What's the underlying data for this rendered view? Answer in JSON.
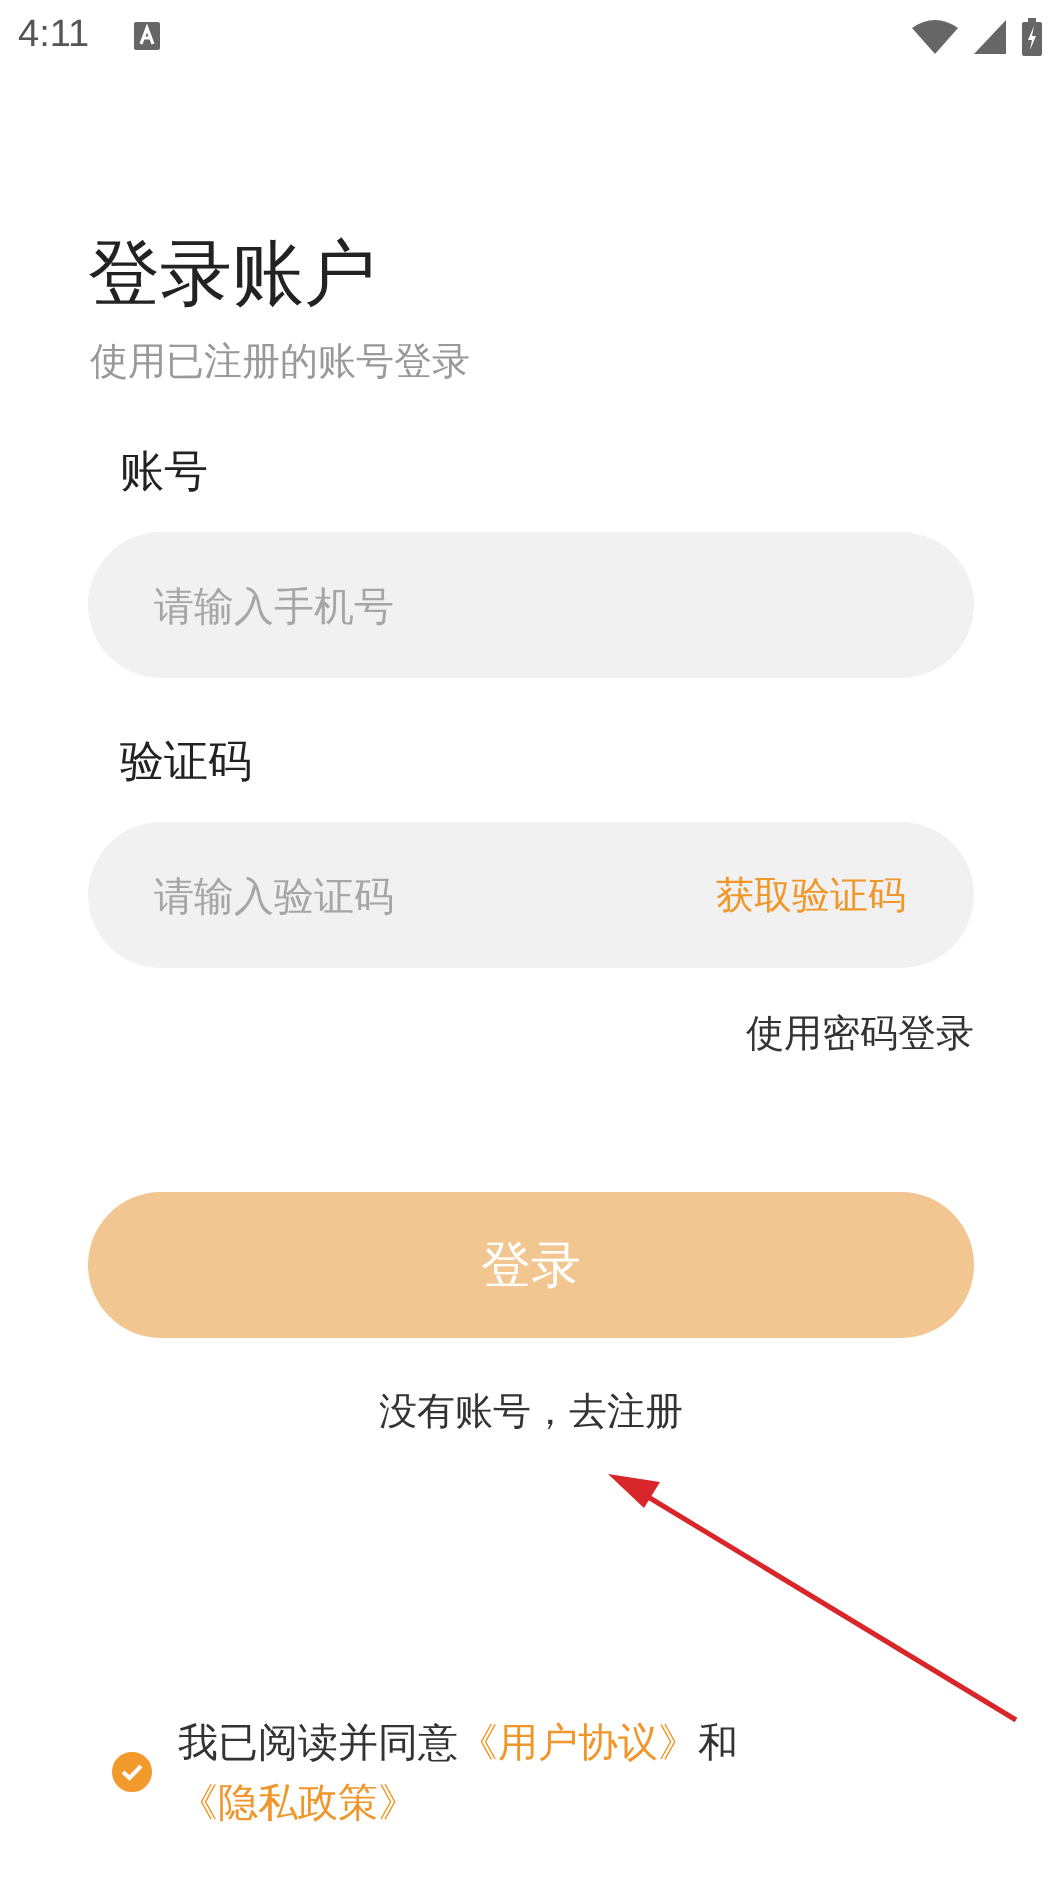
{
  "status_bar": {
    "time": "4:11"
  },
  "title": "登录账户",
  "subtitle": "使用已注册的账号登录",
  "fields": [
    {
      "label": "账号",
      "placeholder": "请输入手机号"
    },
    {
      "label": "验证码",
      "placeholder": "请输入验证码",
      "action": "获取验证码"
    }
  ],
  "password_login_link": "使用密码登录",
  "login_button": {
    "label": "登录",
    "disabled": true
  },
  "register_link": "没有账号，去注册",
  "agreement": {
    "checked": true,
    "parts": [
      {
        "kind": "text",
        "text": "我已阅读并同意"
      },
      {
        "kind": "link",
        "text": "《用户协议》"
      },
      {
        "kind": "text",
        "text": "和"
      },
      {
        "kind": "link",
        "text": "《隐私政策》"
      }
    ]
  }
}
